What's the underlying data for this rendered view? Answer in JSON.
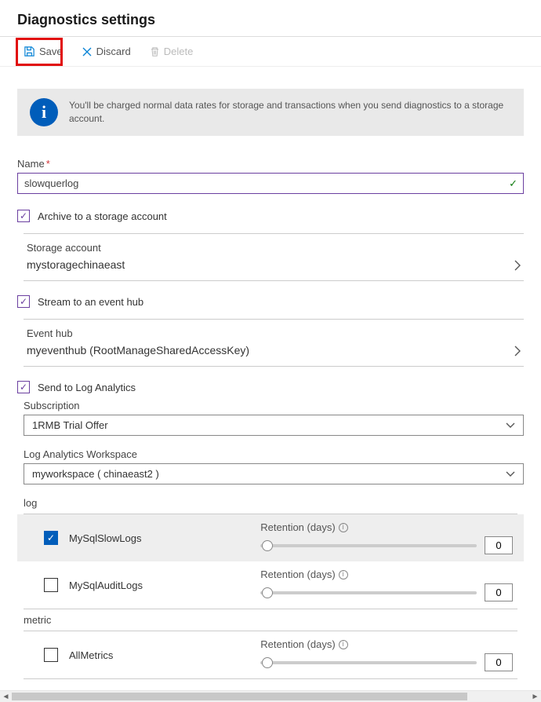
{
  "title": "Diagnostics settings",
  "toolbar": {
    "save": "Save",
    "discard": "Discard",
    "delete": "Delete"
  },
  "banner": "You'll be charged normal data rates for storage and transactions when you send diagnostics to a storage account.",
  "name_label": "Name",
  "name_value": "slowquerlog",
  "archive_label": "Archive to a storage account",
  "storage_label": "Storage account",
  "storage_value": "mystoragechinaeast",
  "stream_label": "Stream to an event hub",
  "eventhub_label": "Event hub",
  "eventhub_value": "myeventhub (RootManageSharedAccessKey)",
  "la_label": "Send to Log Analytics",
  "sub_label": "Subscription",
  "sub_value": "1RMB Trial Offer",
  "ws_label": "Log Analytics Workspace",
  "ws_value": "myworkspace ( chinaeast2 )",
  "log_section": "log",
  "metric_section": "metric",
  "retention_label": "Retention (days)",
  "logs": [
    {
      "name": "MySqlSlowLogs",
      "checked": true,
      "retention": 0
    },
    {
      "name": "MySqlAuditLogs",
      "checked": false,
      "retention": 0
    }
  ],
  "metrics": [
    {
      "name": "AllMetrics",
      "checked": false,
      "retention": 0
    }
  ]
}
